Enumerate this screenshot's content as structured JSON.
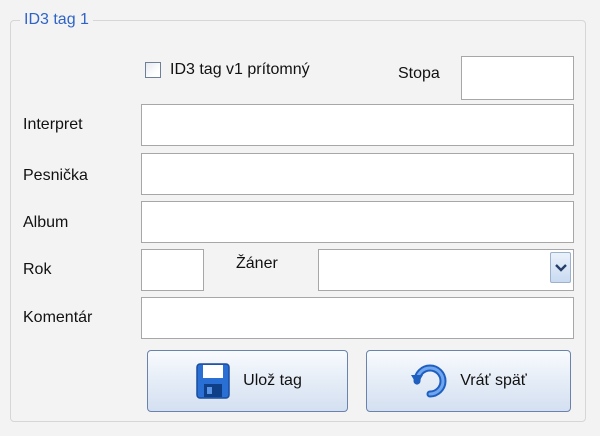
{
  "groupbox": {
    "title": "ID3 tag 1"
  },
  "id3v1": {
    "label": "ID3 tag v1 prítomný",
    "checked": false
  },
  "track": {
    "label": "Stopa",
    "value": ""
  },
  "artist": {
    "label": "Interpret",
    "value": ""
  },
  "song": {
    "label": "Pesnička",
    "value": ""
  },
  "album": {
    "label": "Album",
    "value": ""
  },
  "year": {
    "label": "Rok",
    "value": ""
  },
  "genre": {
    "label": "Žáner",
    "value": ""
  },
  "comment": {
    "label": "Komentár",
    "value": ""
  },
  "buttons": {
    "save": "Ulož tag",
    "revert": "Vráť späť"
  },
  "icons": {
    "save": "floppy-disk-icon",
    "revert": "undo-arrow-icon"
  },
  "colors": {
    "title": "#2f63c6",
    "accent": "#2a6fd4"
  }
}
